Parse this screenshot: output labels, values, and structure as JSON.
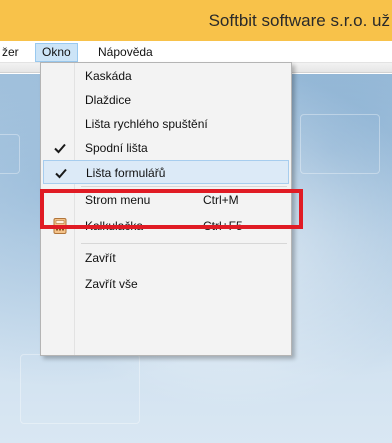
{
  "window": {
    "title": "Softbit software s.r.o. už"
  },
  "menubar": {
    "items": [
      {
        "label": "žer"
      },
      {
        "label": "Okno"
      },
      {
        "label": "Nápověda"
      }
    ]
  },
  "okno_menu": {
    "items": [
      {
        "label": "Kaskáda"
      },
      {
        "label": "Dlaždice"
      },
      {
        "label": "Lišta rychlého spuštění"
      },
      {
        "label": "Spodní lišta",
        "checked": true
      },
      {
        "label": "Lišta formulářů",
        "checked": true,
        "highlighted": true
      },
      {
        "label": "Strom menu",
        "shortcut": "Ctrl+M"
      },
      {
        "label": "Kalkulačka",
        "shortcut": "Ctrl+F5",
        "icon": "calculator-icon"
      },
      {
        "label": "Zavřít"
      },
      {
        "label": "Zavřít vše"
      }
    ]
  },
  "colors": {
    "titlebar": "#f8c24a",
    "menu_active": "#cce4f7",
    "highlight": "#dceaf7",
    "annotation": "#e01b24"
  }
}
